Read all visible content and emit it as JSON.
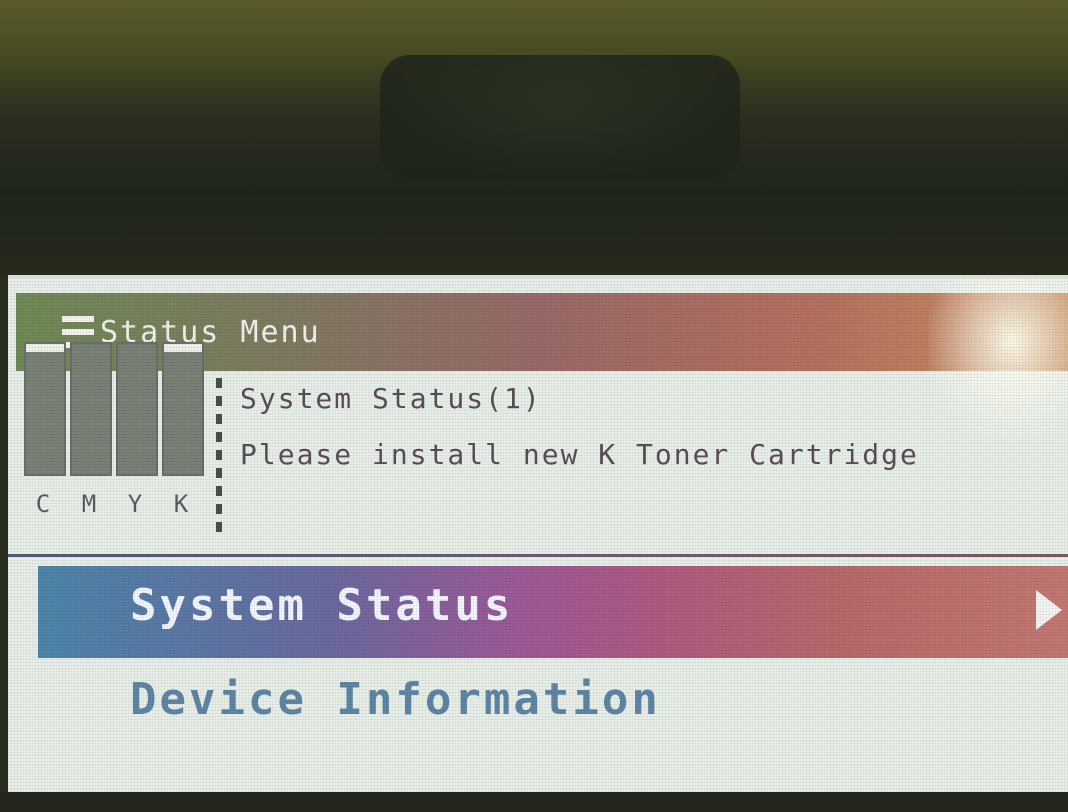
{
  "header": {
    "title": "Status Menu",
    "icon": "menu-list-icon"
  },
  "toner": {
    "cartridges": [
      {
        "label": "C",
        "level": 0.94
      },
      {
        "label": "M",
        "level": 1.0
      },
      {
        "label": "Y",
        "level": 1.0
      },
      {
        "label": "K",
        "level": 0.94
      }
    ]
  },
  "status": {
    "line1": "System Status(1)",
    "line2": "Please install new K Toner Cartridge"
  },
  "menu": {
    "selected": "System Status",
    "item2": "Device Information"
  },
  "colors": {
    "header_start": "#6f8b55",
    "header_end": "#c99060",
    "selected_start": "#4d86aa",
    "selected_end": "#c47872",
    "item_text": "#5f86a4"
  }
}
